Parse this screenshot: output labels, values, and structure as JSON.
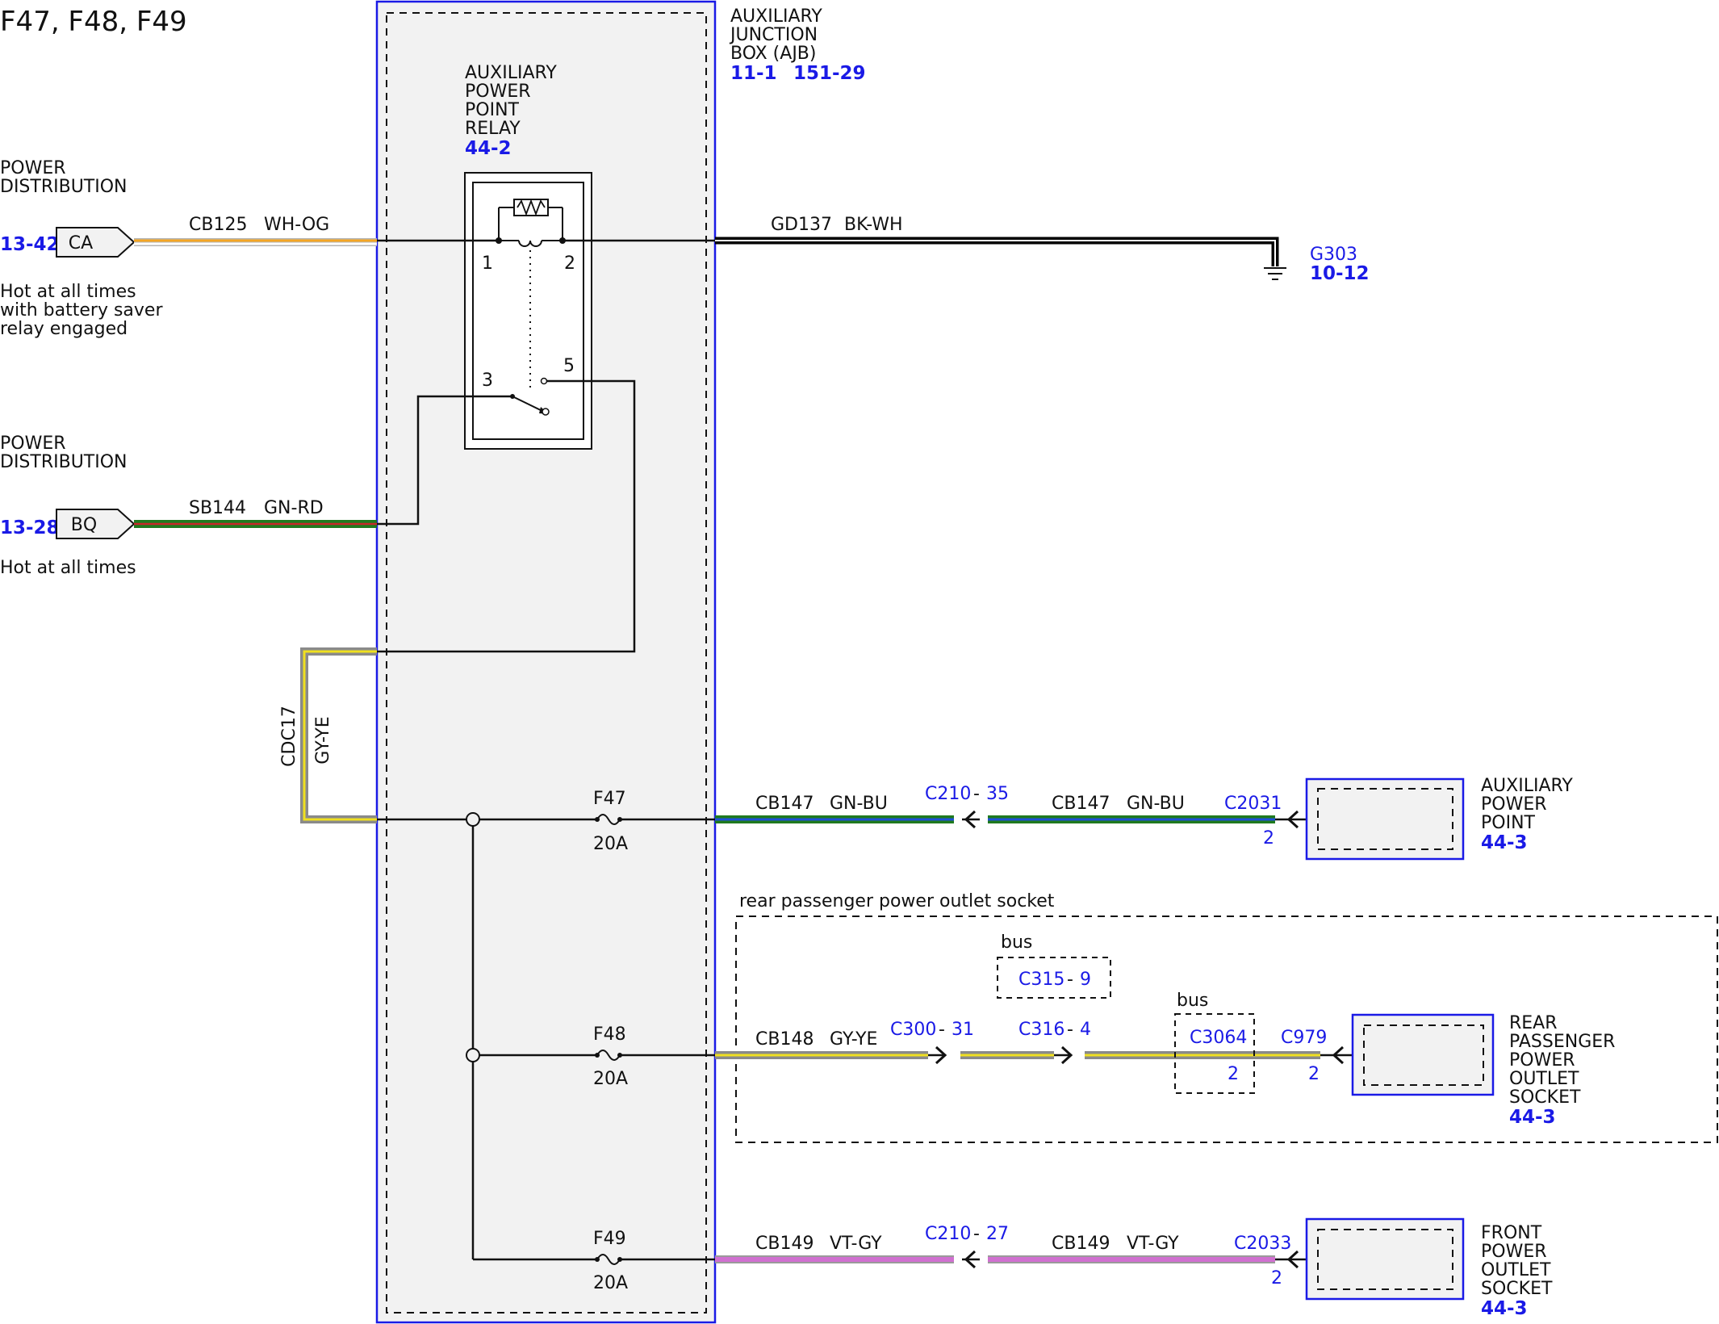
{
  "title": "F47, F48, F49",
  "colors": {
    "reference_blue": "#1a1ae6",
    "box_fill": "#f2f2f2",
    "wire_wh_og": [
      "#f5a623",
      "#ffffff"
    ],
    "wire_gn_rd": [
      "#1f7a1f",
      "#c62828"
    ],
    "wire_bk_wh": [
      "#000000",
      "#ffffff"
    ],
    "wire_gy_ye": [
      "#8a8a8a",
      "#f0e020"
    ],
    "wire_gn_bu": [
      "#1f7a1f",
      "#1e4fd8"
    ],
    "wire_vt_gy": [
      "#d070d0",
      "#9a9a9a"
    ]
  },
  "ajb": {
    "line1": "AUXILIARY",
    "line2": "JUNCTION",
    "line3": "BOX (AJB)",
    "ref1": "11-1",
    "ref2": "151-29"
  },
  "relay": {
    "line1": "AUXILIARY",
    "line2": "POWER",
    "line3": "POINT",
    "line4": "RELAY",
    "ref": "44-2",
    "pin1": "1",
    "pin2": "2",
    "pin3": "3",
    "pin5": "5"
  },
  "inputs": [
    {
      "source_line1": "POWER",
      "source_line2": "DISTRIBUTION",
      "ref": "13-42",
      "connector": "CA",
      "circuit": "CB125",
      "color_code": "WH-OG",
      "note_line1": "Hot at all times",
      "note_line2": "with battery saver",
      "note_line3": "relay engaged"
    },
    {
      "source_line1": "POWER",
      "source_line2": "DISTRIBUTION",
      "ref": "13-28",
      "connector": "BQ",
      "circuit": "SB144",
      "color_code": "GN-RD",
      "note_line1": "Hot at all times"
    }
  ],
  "ground": {
    "circuit": "GD137",
    "color_code": "BK-WH",
    "name": "G303",
    "ref": "10-12"
  },
  "jumper": {
    "circuit": "CDC17",
    "color_code": "GY-YE"
  },
  "fuses": [
    {
      "name": "F47",
      "rating": "20A"
    },
    {
      "name": "F48",
      "rating": "20A"
    },
    {
      "name": "F49",
      "rating": "20A"
    }
  ],
  "outputs": [
    {
      "circuit_a": "CB147",
      "color_a": "GN-BU",
      "inline": "C210",
      "inline_pin": "35",
      "circuit_b": "CB147",
      "color_b": "GN-BU",
      "end_connector": "C2031",
      "end_pin": "2",
      "dest_line1": "AUXILIARY",
      "dest_line2": "POWER",
      "dest_line3": "POINT",
      "dest_ref": "44-3"
    },
    {
      "circuit_a": "CB148",
      "color_a": "GY-YE",
      "inline1": "C300",
      "inline1_pin": "31",
      "inline2": "C316",
      "inline2_pin": "4",
      "bus_top_label": "bus",
      "bus_top_connector": "C315",
      "bus_top_pin": "9",
      "bus_label": "bus",
      "bus_connector": "C3064",
      "bus_pin": "2",
      "end_connector": "C979",
      "end_pin": "2",
      "dest_line1": "REAR",
      "dest_line2": "PASSENGER",
      "dest_line3": "POWER",
      "dest_line4": "OUTLET",
      "dest_line5": "SOCKET",
      "dest_ref": "44-3",
      "group_label": "rear passenger power outlet socket"
    },
    {
      "circuit_a": "CB149",
      "color_a": "VT-GY",
      "inline": "C210",
      "inline_pin": "27",
      "circuit_b": "CB149",
      "color_b": "VT-GY",
      "end_connector": "C2033",
      "end_pin": "2",
      "dest_line1": "FRONT",
      "dest_line2": "POWER",
      "dest_line3": "OUTLET",
      "dest_line4": "SOCKET",
      "dest_ref": "44-3"
    }
  ]
}
